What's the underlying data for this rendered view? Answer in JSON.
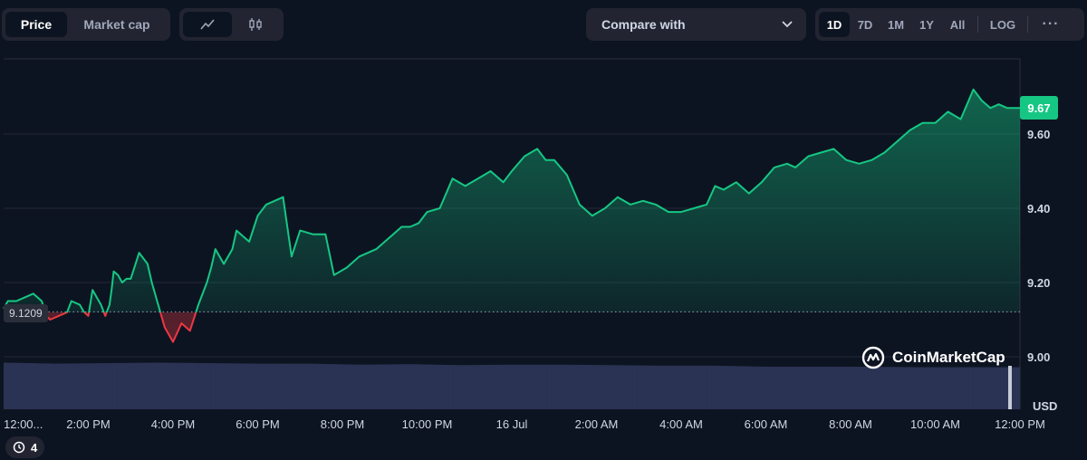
{
  "toolbar": {
    "price_tab": "Price",
    "market_cap_tab": "Market cap",
    "line_chart_icon": "line-chart-icon",
    "candlestick_icon": "candlestick-icon",
    "compare_label": "Compare with",
    "ranges": [
      "1D",
      "7D",
      "1M",
      "1Y",
      "All"
    ],
    "active_range": "1D",
    "log_label": "LOG",
    "more_label": "···"
  },
  "badges": {
    "current_price": "9.67",
    "open_price": "9.1209",
    "history_count": "4"
  },
  "watermark": "CoinMarketCap",
  "colors": {
    "background": "#0d1421",
    "up": "#16c784",
    "down": "#ea3943",
    "volume": "#2a3353"
  },
  "chart_data": {
    "type": "area",
    "title": "",
    "currency": "USD",
    "ylim": [
      9.0,
      9.74
    ],
    "yticks": [
      "9.00",
      "9.20",
      "9.40",
      "9.60"
    ],
    "xticks": [
      "12:00...",
      "2:00 PM",
      "4:00 PM",
      "6:00 PM",
      "8:00 PM",
      "10:00 PM",
      "16 Jul",
      "2:00 AM",
      "4:00 AM",
      "6:00 AM",
      "8:00 AM",
      "10:00 AM",
      "12:00 PM"
    ],
    "reference_price": 9.1209,
    "current_price": 9.67,
    "hours": [
      0,
      0.1,
      0.3,
      0.5,
      0.7,
      0.9,
      1.0,
      1.1,
      1.3,
      1.5,
      1.6,
      1.8,
      1.9,
      2.0,
      2.1,
      2.3,
      2.4,
      2.5,
      2.55,
      2.6,
      2.7,
      2.8,
      2.9,
      3.0,
      3.2,
      3.4,
      3.5,
      3.6,
      3.8,
      4.0,
      4.2,
      4.4,
      4.6,
      4.8,
      4.9,
      5.0,
      5.2,
      5.4,
      5.5,
      5.6,
      5.8,
      6.0,
      6.2,
      6.4,
      6.6,
      6.8,
      7.0,
      7.3,
      7.6,
      7.8,
      8.1,
      8.4,
      8.6,
      8.8,
      9.0,
      9.2,
      9.4,
      9.6,
      9.8,
      10.0,
      10.3,
      10.6,
      10.9,
      11.2,
      11.5,
      11.8,
      12.0,
      12.3,
      12.6,
      12.8,
      13.0,
      13.3,
      13.6,
      13.9,
      14.2,
      14.5,
      14.8,
      15.1,
      15.4,
      15.7,
      16.0,
      16.3,
      16.6,
      16.8,
      17.0,
      17.3,
      17.6,
      17.9,
      18.2,
      18.5,
      18.7,
      19.0,
      19.3,
      19.6,
      19.9,
      20.2,
      20.5,
      20.8,
      21.1,
      21.4,
      21.7,
      22.0,
      22.3,
      22.6,
      22.9,
      23.1,
      23.3,
      23.5,
      23.7,
      24.0
    ],
    "prices": [
      9.13,
      9.15,
      9.15,
      9.16,
      9.17,
      9.15,
      9.11,
      9.1,
      9.11,
      9.12,
      9.15,
      9.14,
      9.12,
      9.11,
      9.18,
      9.14,
      9.11,
      9.14,
      9.18,
      9.23,
      9.22,
      9.2,
      9.21,
      9.21,
      9.28,
      9.25,
      9.2,
      9.16,
      9.08,
      9.04,
      9.09,
      9.07,
      9.14,
      9.2,
      9.24,
      9.29,
      9.25,
      9.29,
      9.34,
      9.33,
      9.31,
      9.38,
      9.41,
      9.42,
      9.43,
      9.27,
      9.34,
      9.33,
      9.33,
      9.22,
      9.24,
      9.27,
      9.28,
      9.29,
      9.31,
      9.33,
      9.35,
      9.35,
      9.36,
      9.39,
      9.4,
      9.48,
      9.46,
      9.48,
      9.5,
      9.47,
      9.5,
      9.54,
      9.56,
      9.53,
      9.53,
      9.49,
      9.41,
      9.38,
      9.4,
      9.43,
      9.41,
      9.42,
      9.41,
      9.39,
      9.39,
      9.4,
      9.41,
      9.46,
      9.45,
      9.47,
      9.44,
      9.47,
      9.51,
      9.52,
      9.51,
      9.54,
      9.55,
      9.56,
      9.53,
      9.52,
      9.53,
      9.55,
      9.58,
      9.61,
      9.63,
      9.63,
      9.66,
      9.64,
      9.72,
      9.69,
      9.67,
      9.68,
      9.67,
      9.67
    ],
    "volume_ratio": [
      0.92,
      0.9,
      0.91,
      0.92,
      0.91,
      0.9,
      0.9,
      0.88,
      0.89,
      0.87,
      0.88,
      0.88,
      0.87,
      0.86,
      0.86,
      0.84,
      0.84,
      0.84,
      0.83,
      0.83,
      0.83
    ]
  }
}
